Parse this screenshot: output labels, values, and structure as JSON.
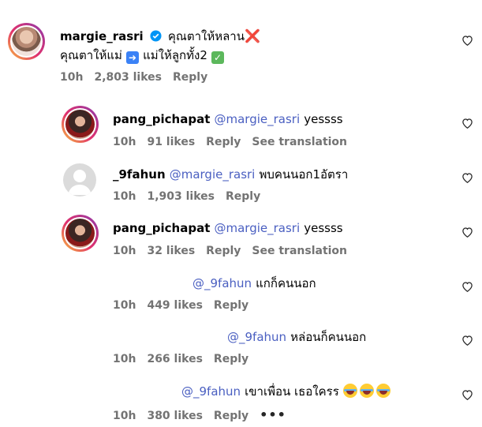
{
  "comments": [
    {
      "username": "margie_rasri",
      "line1": "คุณตาให้หลาน",
      "emoji1": "❌",
      "line2": "คุณตาให้แม่",
      "emoji2": "➡️",
      "line2b": "แม่ให้ลูกทั้ง2",
      "emoji3": "✅",
      "time": "10h",
      "likes": "2,803 likes",
      "reply": "Reply"
    },
    {
      "username": "pang_pichapat",
      "mention": "@margie_rasri",
      "text": "yessss",
      "time": "10h",
      "likes": "91 likes",
      "reply": "Reply",
      "translate": "See translation"
    },
    {
      "username": "_9fahun",
      "mention": "@margie_rasri",
      "text": "พบคนนอก1อัตรา",
      "time": "10h",
      "likes": "1,903 likes",
      "reply": "Reply"
    },
    {
      "username": "pang_pichapat",
      "mention": "@margie_rasri",
      "text": "yessss",
      "time": "10h",
      "likes": "32 likes",
      "reply": "Reply",
      "translate": "See translation"
    },
    {
      "mention": "@_9fahun",
      "text": "แกก็คนนอก",
      "time": "10h",
      "likes": "449 likes",
      "reply": "Reply"
    },
    {
      "mention": "@_9fahun",
      "text": "หล่อนก็คนนอก",
      "time": "10h",
      "likes": "266 likes",
      "reply": "Reply"
    },
    {
      "mention": "@_9fahun",
      "text": "เขาเพื่อน เธอใครร",
      "emoji": "laughing-tears",
      "time": "10h",
      "likes": "380 likes",
      "reply": "Reply",
      "more": "•••"
    }
  ],
  "colors": {
    "mention": "#4a5fc1",
    "meta": "#737373",
    "verified": "#0095f6"
  }
}
